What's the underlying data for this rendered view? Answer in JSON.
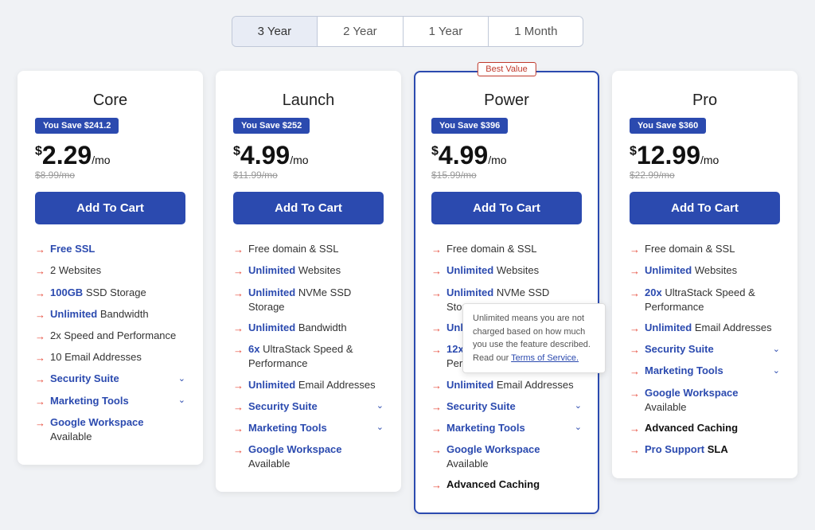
{
  "tabs": [
    {
      "id": "3year",
      "label": "3 Year",
      "active": true
    },
    {
      "id": "2year",
      "label": "2 Year",
      "active": false
    },
    {
      "id": "1year",
      "label": "1 Year",
      "active": false
    },
    {
      "id": "1month",
      "label": "1 Month",
      "active": false
    }
  ],
  "plans": [
    {
      "id": "core",
      "name": "Core",
      "featured": false,
      "bestValue": false,
      "savings": "You Save $241.2",
      "price": "$2.29",
      "priceSuffix": "/mo",
      "originalPrice": "$8.99/mo",
      "addToCart": "Add To Cart",
      "features": [
        {
          "highlight": "Free SSL",
          "rest": "",
          "hasChevron": false,
          "bold": false
        },
        {
          "highlight": "",
          "rest": "2 Websites",
          "hasChevron": false,
          "bold": false
        },
        {
          "highlight": "100GB",
          "rest": " SSD Storage",
          "hasChevron": false,
          "bold": false
        },
        {
          "highlight": "Unlimited",
          "rest": " Bandwidth",
          "hasChevron": false,
          "bold": false
        },
        {
          "highlight": "",
          "rest": "2x Speed and Performance",
          "hasChevron": false,
          "bold": false
        },
        {
          "highlight": "",
          "rest": "10 Email Addresses",
          "hasChevron": false,
          "bold": false
        },
        {
          "highlight": "Security Suite",
          "rest": "",
          "hasChevron": true,
          "bold": false
        },
        {
          "highlight": "Marketing Tools",
          "rest": "",
          "hasChevron": true,
          "bold": false
        },
        {
          "highlight": "Google Workspace",
          "rest": " Available",
          "hasChevron": false,
          "bold": false
        }
      ]
    },
    {
      "id": "launch",
      "name": "Launch",
      "featured": false,
      "bestValue": false,
      "savings": "You Save $252",
      "price": "$4.99",
      "priceSuffix": "/mo",
      "originalPrice": "$11.99/mo",
      "addToCart": "Add To Cart",
      "features": [
        {
          "highlight": "",
          "rest": "Free domain & SSL",
          "hasChevron": false,
          "bold": false
        },
        {
          "highlight": "Unlimited",
          "rest": " Websites",
          "hasChevron": false,
          "bold": false
        },
        {
          "highlight": "Unlimited",
          "rest": " NVMe SSD Storage",
          "hasChevron": false,
          "bold": false
        },
        {
          "highlight": "Unlimited",
          "rest": " Bandwidth",
          "hasChevron": false,
          "bold": false
        },
        {
          "highlight": "6x",
          "rest": " UltraStack Speed & Performance",
          "hasChevron": false,
          "bold": false
        },
        {
          "highlight": "Unlimited",
          "rest": " Email Addresses",
          "hasChevron": false,
          "bold": false
        },
        {
          "highlight": "Security Suite",
          "rest": "",
          "hasChevron": true,
          "bold": false
        },
        {
          "highlight": "Marketing Tools",
          "rest": "",
          "hasChevron": true,
          "bold": false
        },
        {
          "highlight": "Google Workspace",
          "rest": " Available",
          "hasChevron": false,
          "bold": false
        }
      ]
    },
    {
      "id": "power",
      "name": "Power",
      "featured": true,
      "bestValue": true,
      "savings": "You Save $396",
      "price": "$4.99",
      "priceSuffix": "/mo",
      "originalPrice": "$15.99/mo",
      "addToCart": "Add To Cart",
      "features": [
        {
          "highlight": "",
          "rest": "Free domain & SSL",
          "hasChevron": false,
          "bold": false
        },
        {
          "highlight": "Unlimited",
          "rest": " Websites",
          "hasChevron": false,
          "bold": false
        },
        {
          "highlight": "Unlimited",
          "rest": " NVMe SSD Storage",
          "hasChevron": false,
          "bold": false
        },
        {
          "highlight": "Unlimited",
          "rest": " Bandwidth",
          "hasChevron": false,
          "bold": false
        },
        {
          "highlight": "12x",
          "rest": " UltraStack Speed & Performance",
          "hasChevron": false,
          "bold": false
        },
        {
          "highlight": "Unlimited",
          "rest": " Email Addresses",
          "hasChevron": false,
          "bold": false
        },
        {
          "highlight": "Security Suite",
          "rest": "",
          "hasChevron": true,
          "bold": false
        },
        {
          "highlight": "Marketing Tools",
          "rest": "",
          "hasChevron": true,
          "bold": false
        },
        {
          "highlight": "Google Workspace",
          "rest": " Available",
          "hasChevron": false,
          "bold": false
        },
        {
          "highlight": "",
          "rest": "Advanced Caching",
          "hasChevron": false,
          "bold": true
        }
      ],
      "tooltip": "Unlimited means you are not charged based on how much you use the feature described. Read our Terms of Service."
    },
    {
      "id": "pro",
      "name": "Pro",
      "featured": false,
      "bestValue": false,
      "savings": "You Save $360",
      "price": "$12.99",
      "priceSuffix": "/mo",
      "originalPrice": "$22.99/mo",
      "addToCart": "Add To Cart",
      "features": [
        {
          "highlight": "",
          "rest": "Free domain & SSL",
          "hasChevron": false,
          "bold": false
        },
        {
          "highlight": "Unlimited",
          "rest": " Websites",
          "hasChevron": false,
          "bold": false
        },
        {
          "highlight": "20x",
          "rest": " UltraStack Speed & Performance",
          "hasChevron": false,
          "bold": false
        },
        {
          "highlight": "Unlimited",
          "rest": " Email Addresses",
          "hasChevron": false,
          "bold": false
        },
        {
          "highlight": "Security Suite",
          "rest": "",
          "hasChevron": true,
          "bold": false
        },
        {
          "highlight": "Marketing Tools",
          "rest": "",
          "hasChevron": true,
          "bold": false
        },
        {
          "highlight": "Google Workspace",
          "rest": " Available",
          "hasChevron": false,
          "bold": false
        },
        {
          "highlight": "",
          "rest": "Advanced Caching",
          "hasChevron": false,
          "bold": true
        },
        {
          "highlight": "Pro Support",
          "rest": " SLA",
          "hasChevron": false,
          "bold": true
        }
      ]
    }
  ],
  "tooltip": {
    "text": "Unlimited means you are not charged based on how much you use the feature described. Read our",
    "linkText": "Terms of Service."
  }
}
